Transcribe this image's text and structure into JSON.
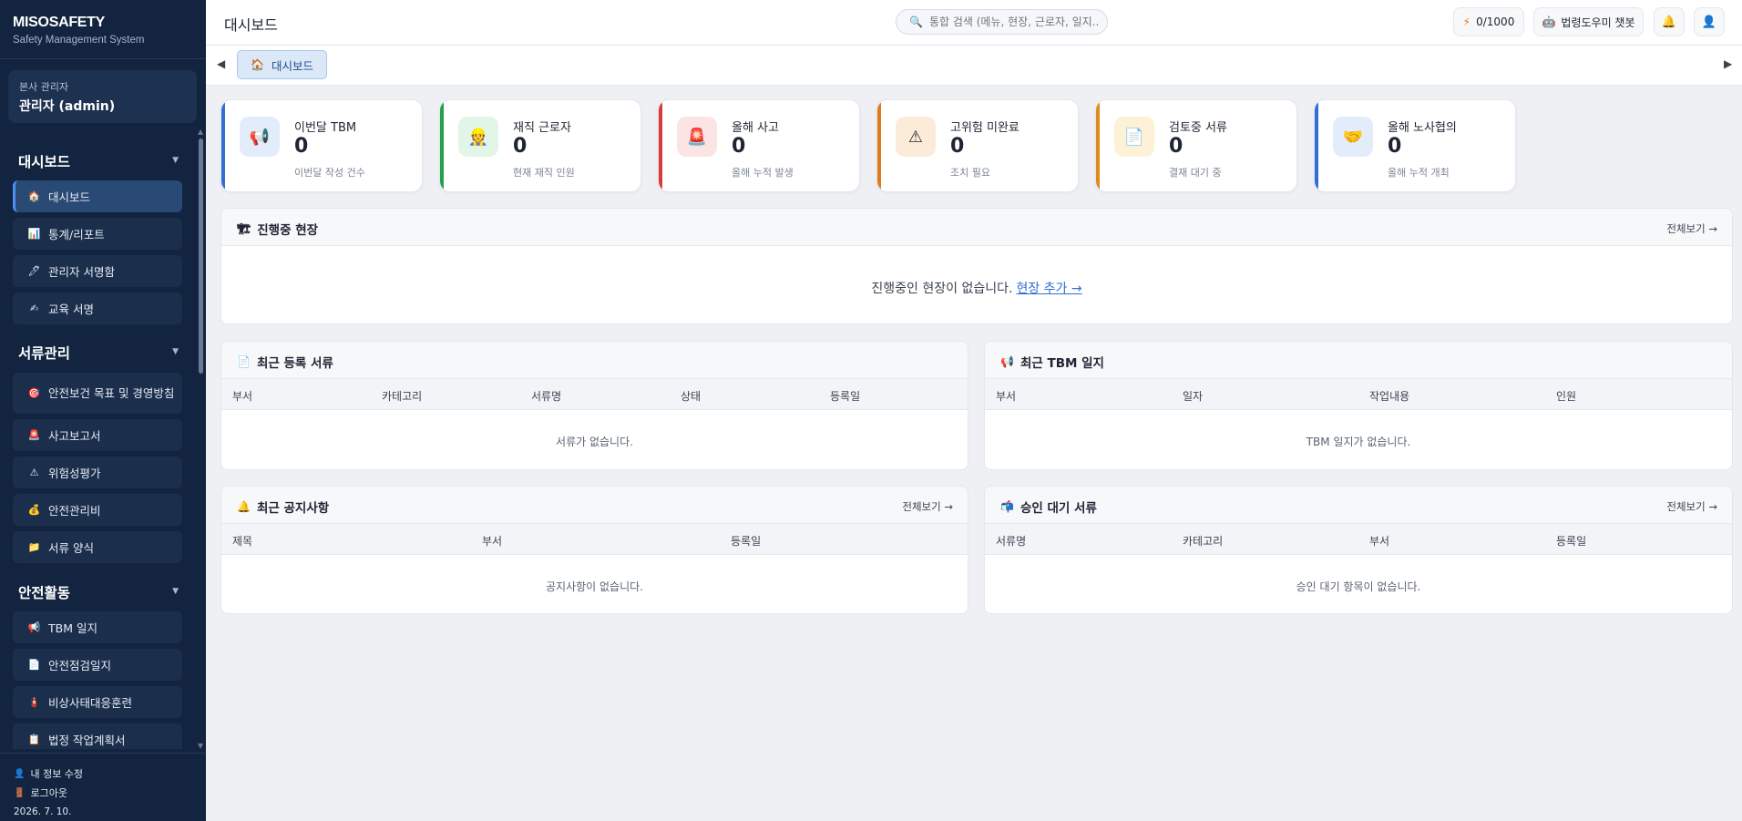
{
  "brand": {
    "name": "MISOSAFETY",
    "subtitle": "Safety Management System"
  },
  "user": {
    "role": "본사 관리자",
    "name": "관리자 (admin)"
  },
  "sidebar": {
    "sections": [
      {
        "title": "대시보드",
        "items": [
          {
            "icon": "🏠",
            "label": "대시보드",
            "active": true
          },
          {
            "icon": "📊",
            "label": "통계/리포트"
          },
          {
            "icon": "🖊",
            "label": "관리자 서명함"
          },
          {
            "icon": "✍",
            "label": "교육 서명"
          }
        ]
      },
      {
        "title": "서류관리",
        "items": [
          {
            "icon": "🎯",
            "label": "안전보건 목표 및 경영방침"
          },
          {
            "icon": "🚨",
            "label": "사고보고서"
          },
          {
            "icon": "⚠",
            "label": "위험성평가"
          },
          {
            "icon": "💰",
            "label": "안전관리비"
          },
          {
            "icon": "📁",
            "label": "서류 양식"
          }
        ]
      },
      {
        "title": "안전활동",
        "items": [
          {
            "icon": "📢",
            "label": "TBM 일지"
          },
          {
            "icon": "📄",
            "label": "안전점검일지"
          },
          {
            "icon": "🧯",
            "label": "비상사태대응훈련"
          },
          {
            "icon": "📋",
            "label": "법정 작업계획서"
          }
        ]
      }
    ],
    "footer": {
      "edit_profile": "내 정보 수정",
      "logout": "로그아웃",
      "date": "2026. 7. 10."
    }
  },
  "header": {
    "title": "대시보드",
    "search_placeholder": "통합 검색 (메뉴, 현장, 근로자, 일지...",
    "credits": "0/1000",
    "chatbot": "법령도우미 챗봇"
  },
  "tabs": [
    {
      "icon": "🏠",
      "label": "대시보드"
    }
  ],
  "stats": [
    {
      "icon": "📢",
      "label": "이번달 TBM",
      "value": "0",
      "sub": "이번달 작성 건수",
      "accent": "#2f6ed6",
      "bg": "#e3ecfb"
    },
    {
      "icon": "👷",
      "label": "재직 근로자",
      "value": "0",
      "sub": "현재 재직 인원",
      "accent": "#1fa34a",
      "bg": "#e2f6e8"
    },
    {
      "icon": "🚨",
      "label": "올해 사고",
      "value": "0",
      "sub": "올해 누적 발생",
      "accent": "#d83a3a",
      "bg": "#fbe4e4"
    },
    {
      "icon": "⚠",
      "label": "고위험 미완료",
      "value": "0",
      "sub": "조치 필요",
      "accent": "#e07a1f",
      "bg": "#fcebd9"
    },
    {
      "icon": "📄",
      "label": "검토중 서류",
      "value": "0",
      "sub": "결재 대기 중",
      "accent": "#e08a1f",
      "bg": "#fdf1d6"
    },
    {
      "icon": "🤝",
      "label": "올해 노사협의",
      "value": "0",
      "sub": "올해 누적 개최",
      "accent": "#2f6ed6",
      "bg": "#e3ecfb"
    }
  ],
  "sites": {
    "icon": "🏗",
    "title": "진행중 현장",
    "more": "전체보기 →",
    "empty": "진행중인 현장이 없습니다.",
    "add_link": "현장 추가 →"
  },
  "recent_docs": {
    "icon": "📄",
    "title": "최근 등록 서류",
    "columns": [
      "부서",
      "카테고리",
      "서류명",
      "상태",
      "등록일"
    ],
    "empty": "서류가 없습니다."
  },
  "recent_tbm": {
    "icon": "📢",
    "title": "최근 TBM 일지",
    "columns": [
      "부서",
      "일자",
      "작업내용",
      "인원"
    ],
    "empty": "TBM 일지가 없습니다."
  },
  "notices": {
    "icon": "🔔",
    "title": "최근 공지사항",
    "more": "전체보기 →",
    "columns": [
      "제목",
      "부서",
      "등록일"
    ],
    "empty": "공지사항이 없습니다."
  },
  "approvals": {
    "icon": "📬",
    "title": "승인 대기 서류",
    "more": "전체보기 →",
    "columns": [
      "서류명",
      "카테고리",
      "부서",
      "등록일"
    ],
    "empty": "승인 대기 항목이 없습니다."
  }
}
